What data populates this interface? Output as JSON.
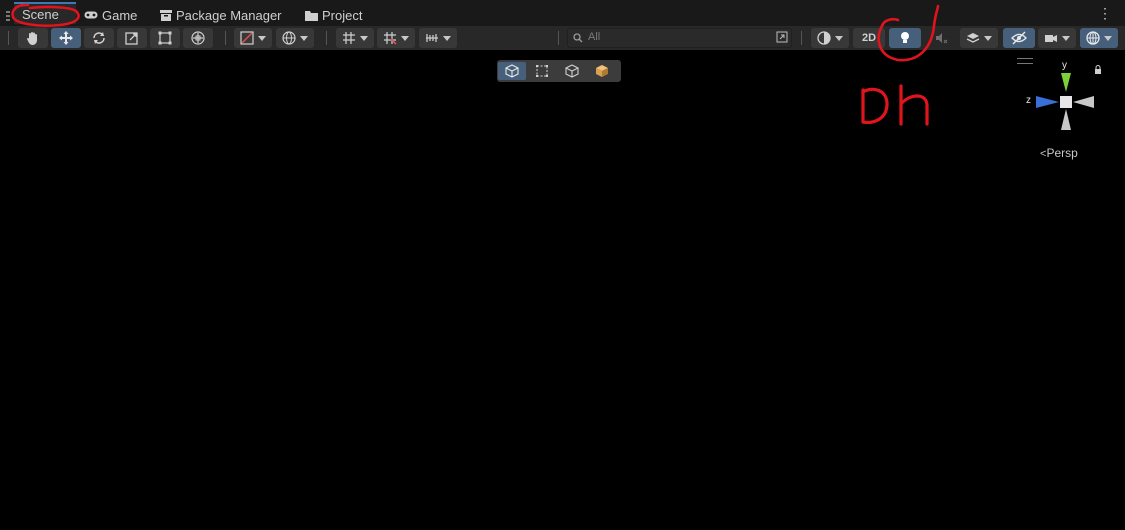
{
  "tabs": [
    {
      "label": "Scene",
      "icon": "scene-icon"
    },
    {
      "label": "Game",
      "icon": "gamepad-icon"
    },
    {
      "label": "Package Manager",
      "icon": "package-icon"
    },
    {
      "label": "Project",
      "icon": "folder-icon"
    }
  ],
  "toolbar": {
    "search_placeholder": "All",
    "mode_2d_label": "2D"
  },
  "gizmo": {
    "y_label": "y",
    "z_label": "z",
    "projection_label": "Persp"
  },
  "annotations": {
    "handwritten_note": "on"
  },
  "colors": {
    "accent": "#3a79bb",
    "toggle_on": "#46607c",
    "annotation": "#e0141c"
  }
}
